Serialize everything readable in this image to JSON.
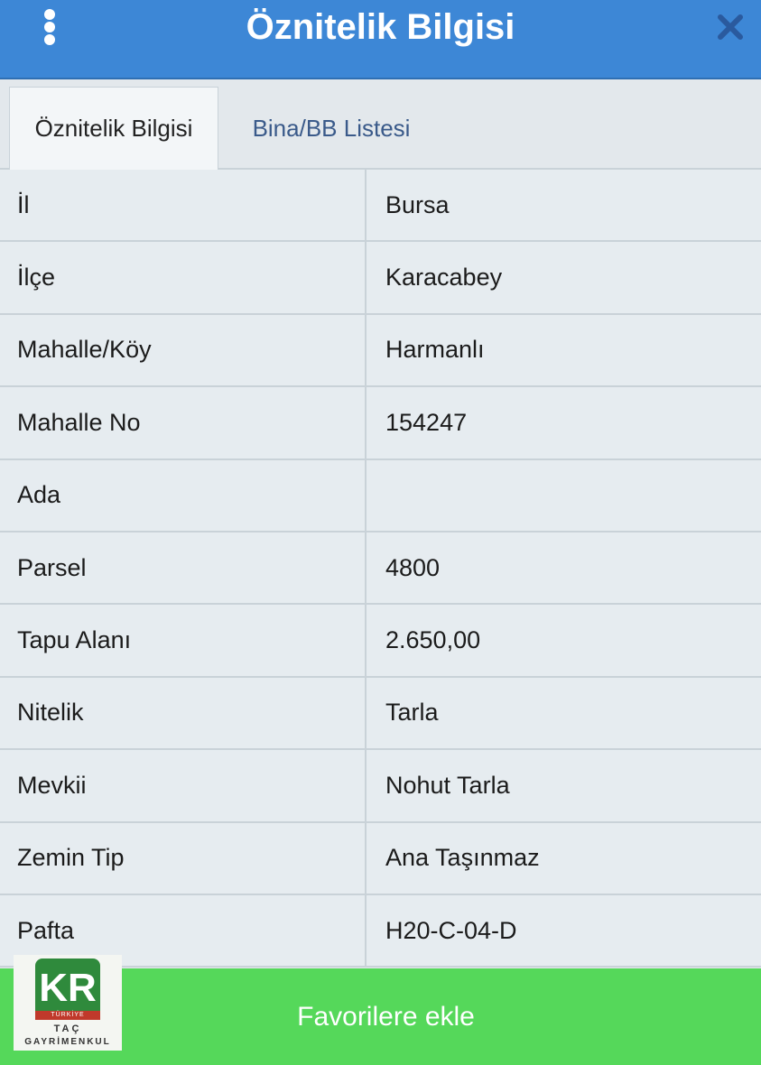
{
  "header": {
    "title": "Öznitelik Bilgisi",
    "menu_icon": "kebab-menu-icon",
    "close_icon": "close-icon"
  },
  "tabs": [
    {
      "label": "Öznitelik Bilgisi",
      "active": true
    },
    {
      "label": "Bina/BB Listesi",
      "active": false
    }
  ],
  "rows": [
    {
      "label": "İl",
      "value": "Bursa"
    },
    {
      "label": "İlçe",
      "value": "Karacabey"
    },
    {
      "label": "Mahalle/Köy",
      "value": "Harmanlı"
    },
    {
      "label": "Mahalle No",
      "value": "154247"
    },
    {
      "label": "Ada",
      "value": ""
    },
    {
      "label": "Parsel",
      "value": "4800"
    },
    {
      "label": "Tapu Alanı",
      "value": "2.650,00"
    },
    {
      "label": "Nitelik",
      "value": "Tarla"
    },
    {
      "label": "Mevkii",
      "value": "Nohut Tarla"
    },
    {
      "label": "Zemin Tip",
      "value": "Ana Taşınmaz"
    },
    {
      "label": "Pafta",
      "value": "H20-C-04-D"
    }
  ],
  "footer": {
    "button_label": "Favorilere ekle"
  },
  "logo": {
    "mark": "KR",
    "bar": "TÜRKİYE",
    "line1": "TAÇ",
    "line2": "GAYRİMENKUL"
  },
  "colors": {
    "header": "#3d87d6",
    "footer": "#55d85a",
    "tab_inactive_text": "#3a5a8a"
  }
}
